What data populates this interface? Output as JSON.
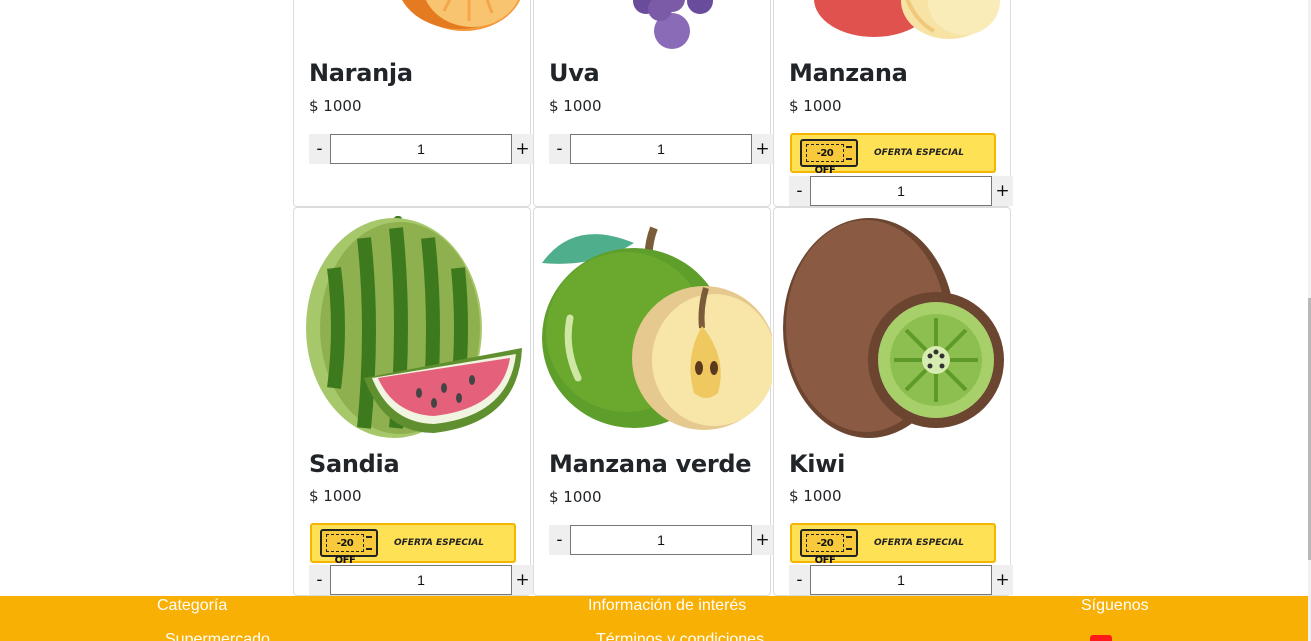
{
  "products": [
    {
      "name": "Naranja",
      "price": "$ 1000",
      "quantity": "1",
      "offer": false
    },
    {
      "name": "Uva",
      "price": "$ 1000",
      "quantity": "1",
      "offer": false
    },
    {
      "name": "Manzana",
      "price": "$ 1000",
      "quantity": "1",
      "offer": true
    },
    {
      "name": "Sandia",
      "price": "$ 1000",
      "quantity": "1",
      "offer": true
    },
    {
      "name": "Manzana verde",
      "price": "$ 1000",
      "quantity": "1",
      "offer": false
    },
    {
      "name": "Kiwi",
      "price": "$ 1000",
      "quantity": "1",
      "offer": true
    }
  ],
  "stepper": {
    "minus": "-",
    "plus": "+"
  },
  "offer_badge": {
    "discount": "-20 OFF",
    "label": "OFERTA ESPECIAL"
  },
  "footer": {
    "category_heading": "Categoría",
    "category_link": "Supermercado",
    "info_heading": "Información de interés",
    "info_link": "Términos y condiciones",
    "follow_heading": "Síguenos",
    "social_icon": "youtube-icon"
  },
  "colors": {
    "footer_bg": "#f9b004",
    "badge_bg": "#ffe156",
    "badge_border": "#f5b400"
  }
}
